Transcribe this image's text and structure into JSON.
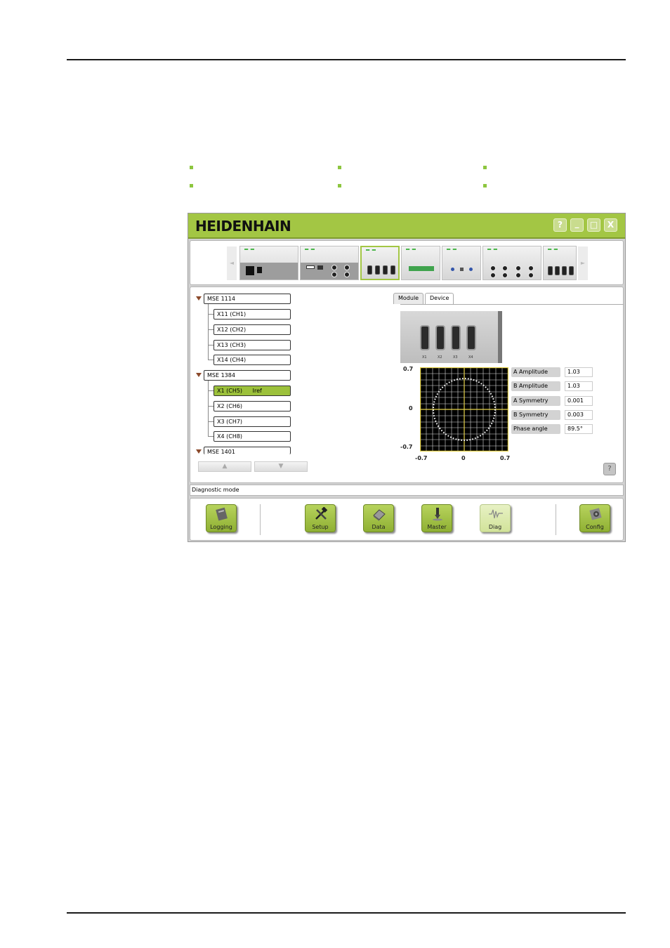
{
  "window": {
    "brand": "HEIDENHAIN",
    "buttons": {
      "help": "?",
      "minimize": "_",
      "maximize": "□",
      "close": "X"
    }
  },
  "module_bar": {
    "prev": "◄",
    "next": "►"
  },
  "tree": {
    "groups": [
      {
        "label": "MSE 1114",
        "items": [
          "X11 (CH1)",
          "X12 (CH2)",
          "X13 (CH3)",
          "X14 (CH4)"
        ]
      },
      {
        "label": "MSE 1384",
        "items": [
          "X1 (CH5)",
          "X2 (CH6)",
          "X3 (CH7)",
          "X4 (CH8)"
        ]
      },
      {
        "label": "MSE 1401",
        "items": []
      }
    ],
    "selected_item_label": "X1 (CH5)",
    "selected_item_extra": "Iref",
    "scroll_up": "▲",
    "scroll_down": "▼"
  },
  "tabs": {
    "module": "Module",
    "device": "Device"
  },
  "device": {
    "port_labels": [
      "X1",
      "X2",
      "X3",
      "X4"
    ]
  },
  "plot": {
    "y_top": "0.7",
    "y_mid": "0",
    "y_bottom": "-0.7",
    "x_left": "-0.7",
    "x_mid": "0",
    "x_right": "0.7"
  },
  "params": [
    {
      "label": "A Amplitude",
      "value": "1.03"
    },
    {
      "label": "B Amplitude",
      "value": "1.03"
    },
    {
      "label": "A Symmetry",
      "value": "0.001"
    },
    {
      "label": "B Symmetry",
      "value": "0.003"
    },
    {
      "label": "Phase angle",
      "value": "89.5°"
    }
  ],
  "help_button": "?",
  "status": "Diagnostic mode",
  "toolbar": {
    "logging": "Logging",
    "setup": "Setup",
    "data": "Data",
    "master": "Master",
    "diag": "Diag",
    "config": "Config"
  },
  "colors": {
    "accent": "#a3c644",
    "selected": "#9cc13b",
    "bullet": "#8dc63f"
  }
}
